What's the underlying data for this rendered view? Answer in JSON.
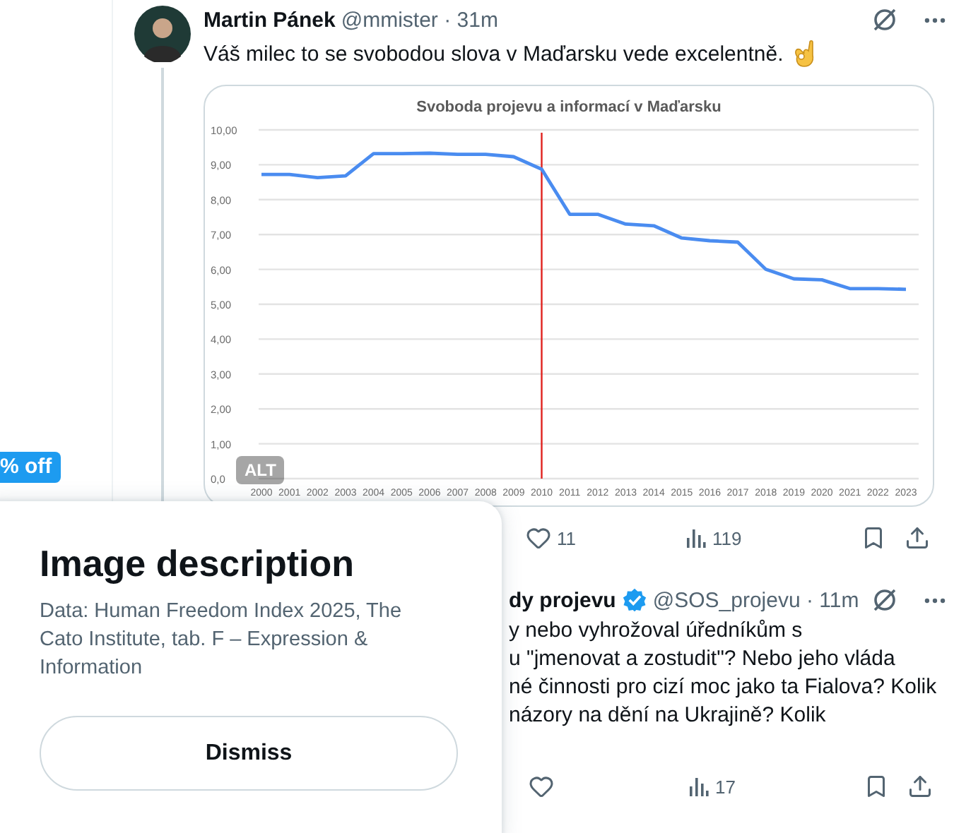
{
  "left_column": {
    "badge": "% off"
  },
  "post": {
    "name": "Martin Pánek",
    "meta": "@mmister · 31m",
    "text": "Váš milec to se svobodou slova v Maďarsku vede excelentně.",
    "media": {
      "alt_badge": "ALT",
      "chart_data": {
        "type": "line",
        "title": "Svoboda projevu a informací v Maďarsku",
        "categories": [
          "2000",
          "2001",
          "2002",
          "2003",
          "2004",
          "2005",
          "2006",
          "2007",
          "2008",
          "2009",
          "2010",
          "2011",
          "2012",
          "2013",
          "2014",
          "2015",
          "2016",
          "2017",
          "2018",
          "2019",
          "2020",
          "2021",
          "2022",
          "2023"
        ],
        "series": [
          {
            "color": "#4a8cf0",
            "values": [
              8.72,
              8.72,
              8.63,
              8.68,
              9.32,
              9.32,
              9.33,
              9.3,
              9.3,
              9.23,
              8.87,
              7.58,
              7.58,
              7.3,
              7.25,
              6.9,
              6.82,
              6.78,
              6.0,
              5.73,
              5.7,
              5.45,
              5.45,
              5.43
            ]
          }
        ],
        "ylim": [
          0,
          10
        ],
        "yticks": [
          {
            "value": 0,
            "label": "0,0"
          },
          {
            "value": 1,
            "label": "1,00"
          },
          {
            "value": 2,
            "label": "2,00"
          },
          {
            "value": 3,
            "label": "3,00"
          },
          {
            "value": 4,
            "label": "4,00"
          },
          {
            "value": 5,
            "label": "5,00"
          },
          {
            "value": 6,
            "label": "6,00"
          },
          {
            "value": 7,
            "label": "7,00"
          },
          {
            "value": 8,
            "label": "8,00"
          },
          {
            "value": 9,
            "label": "9,00"
          },
          {
            "value": 10,
            "label": "10,00"
          }
        ],
        "grid": true,
        "ref_lines": [
          {
            "axis": "x",
            "value": "2010",
            "color": "#e0201c"
          }
        ]
      }
    },
    "actions": [
      {
        "kind": "like",
        "count": "11"
      },
      {
        "kind": "views",
        "count": "119"
      },
      {
        "kind": "bookmark"
      },
      {
        "kind": "share"
      }
    ]
  },
  "reply": {
    "name": "dy projevu",
    "verified": true,
    "meta": "@SOS_projevu · 11m",
    "lines": [
      "y nebo vyhrožoval úředníkům s",
      "u \"jmenovat a zostudit\"? Nebo jeho vláda",
      "né činnosti pro cizí moc jako ta Fialova? Kolik",
      "názory na dění na Ukrajině? Kolik"
    ],
    "actions": [
      {
        "kind": "like"
      },
      {
        "kind": "views",
        "count": "17"
      },
      {
        "kind": "bookmark"
      },
      {
        "kind": "share"
      }
    ]
  },
  "popup": {
    "title": "Image description",
    "text": "Data: Human Freedom Index 2025, The Cato Institute, tab. F – Expression & Information",
    "button": "Dismiss"
  }
}
